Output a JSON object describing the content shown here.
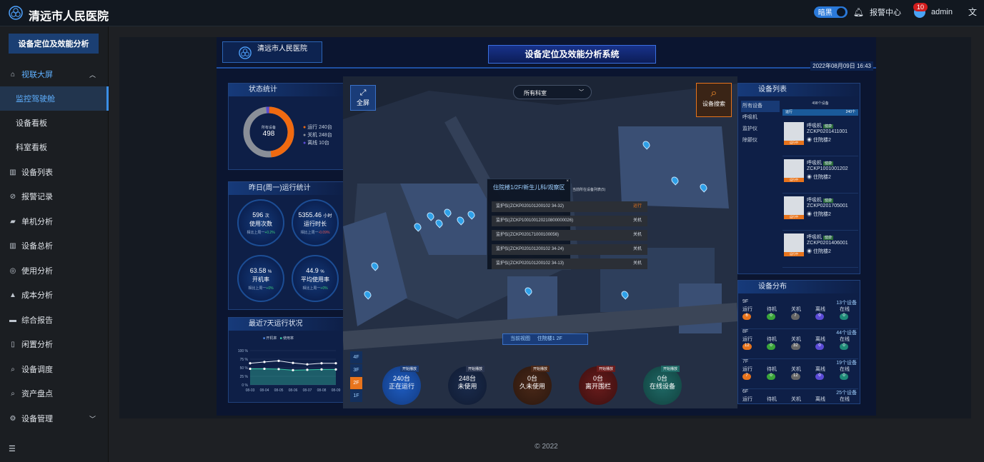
{
  "app": {
    "title": "清远市人民医院"
  },
  "topbar": {
    "theme_label": "暗黑",
    "alarm_label": "报警中心",
    "alarm_count": "10",
    "user": "admin",
    "lang_icon": "translate-icon"
  },
  "sidebar": {
    "title": "设备定位及效能分析",
    "items": [
      {
        "label": "视联大屏",
        "icon": "bank-icon"
      },
      {
        "label": "监控驾驶舱"
      },
      {
        "label": "设备看板"
      },
      {
        "label": "科室看板"
      },
      {
        "label": "设备列表",
        "icon": "bar-chart-icon"
      },
      {
        "label": "报警记录",
        "icon": "compass-icon"
      },
      {
        "label": "单机分析",
        "icon": "device-icon"
      },
      {
        "label": "设备总析",
        "icon": "bar-chart-icon"
      },
      {
        "label": "使用分析",
        "icon": "target-icon"
      },
      {
        "label": "成本分析",
        "icon": "flask-icon"
      },
      {
        "label": "综合报告",
        "icon": "card-icon"
      },
      {
        "label": "闲置分析",
        "icon": "phone-icon"
      },
      {
        "label": "设备调度",
        "icon": "search-icon"
      },
      {
        "label": "资产盘点",
        "icon": "search-icon"
      },
      {
        "label": "设备管理",
        "icon": "gear-icon"
      }
    ]
  },
  "footer": {
    "copyright": "© 2022"
  },
  "screen": {
    "hospital": "清远市人民医院",
    "title": "设备定位及效能分析系统",
    "datetime": "2022年08月09日 16:43",
    "status": {
      "title": "状态统计",
      "center_label": "所有设备",
      "center_value": "498",
      "legend": [
        {
          "label": "运行",
          "value": "240台",
          "color": "#f06a10"
        },
        {
          "label": "关机",
          "value": "248台",
          "color": "#8a8f98"
        },
        {
          "label": "离线",
          "value": "10台",
          "color": "#5b4bd6"
        }
      ]
    },
    "yesterday": {
      "title": "昨日(周一)运行统计",
      "items": [
        {
          "value": "596",
          "unit": "次",
          "label": "使用次数",
          "compare": "相比上周一",
          "delta": "+0.2%"
        },
        {
          "value": "5355.46",
          "unit": "小时",
          "label": "运行时长",
          "compare": "相比上周一",
          "delta": "-0.09%"
        },
        {
          "value": "63.58",
          "unit": "%",
          "label": "开机率",
          "compare": "相比上周一",
          "delta": "+0%"
        },
        {
          "value": "44.9",
          "unit": "%",
          "label": "平均使用率",
          "compare": "相比上周一",
          "delta": "+0%"
        }
      ]
    },
    "week": {
      "title": "最近7天运行状况",
      "legend": [
        "开机率",
        "使用率"
      ]
    },
    "map": {
      "fullscreen": "全屏",
      "dept_select": "所有科室",
      "search": "设备搜索",
      "view_label": "当前视图",
      "view_value": "住院楼1 2F",
      "popup_title": "住院楼1/2F/新生儿科/观察区",
      "popup_sub": "当前所在设备列表(5)",
      "popup_rows": [
        {
          "id": "监护仪(ZCKP020101200102 34-32)",
          "state": "运行",
          "color": "#e8741c"
        },
        {
          "id": "监护仪(ZCKP100100120210800000026)",
          "state": "关机",
          "color": "#888"
        },
        {
          "id": "监护仪(ZCKP020171000100056)",
          "state": "关机",
          "color": "#888"
        },
        {
          "id": "监护仪(ZCKP020101200102 34-24)",
          "state": "关机",
          "color": "#888"
        },
        {
          "id": "监护仪(ZCKP020101200102 34-13)",
          "state": "关机",
          "color": "#888"
        }
      ],
      "floors": [
        "4F",
        "3F",
        "2F",
        "1F"
      ]
    },
    "counts": [
      {
        "value": "240台",
        "label": "正在运行",
        "btn": "开始播放"
      },
      {
        "value": "248台",
        "label": "未使用",
        "btn": "开始播放"
      },
      {
        "value": "0台",
        "label": "久未使用",
        "btn": "开始播放"
      },
      {
        "value": "0台",
        "label": "离开围栏",
        "btn": "开始播放"
      },
      {
        "value": "0台",
        "label": "在线设备",
        "btn": "开始播放"
      }
    ],
    "devices": {
      "title": "设备列表",
      "filters": [
        "所有设备",
        "呼吸机",
        "监护仪",
        "除颤仪"
      ],
      "count_label": "498个设备",
      "tab": "运行",
      "tab_count": "240个",
      "list": [
        {
          "name": "呼吸机",
          "code": "ZCKP0201411001",
          "loc": "住院楼2",
          "status": "运行中",
          "tag": "健康"
        },
        {
          "name": "呼吸机",
          "code": "ZCKP1001001202",
          "loc": "住院楼2",
          "status": "运行中",
          "tag": "健康"
        },
        {
          "name": "呼吸机",
          "code": "ZCKP0201705001",
          "loc": "住院楼2",
          "status": "运行中",
          "tag": "健康"
        },
        {
          "name": "呼吸机",
          "code": "ZCKP0201406001",
          "loc": "住院楼2",
          "status": "运行中",
          "tag": "健康"
        }
      ]
    },
    "distribution": {
      "title": "设备分布",
      "headers": [
        "运行",
        "待机",
        "关机",
        "离线",
        "在线"
      ],
      "floors": [
        {
          "floor": "9F",
          "total": "13个设备",
          "vals": [
            "6",
            "0",
            "7",
            "0",
            "0"
          ]
        },
        {
          "floor": "8F",
          "total": "44个设备",
          "vals": [
            "12",
            "0",
            "32",
            "0",
            "0"
          ]
        },
        {
          "floor": "7F",
          "total": "19个设备",
          "vals": [
            "7",
            "0",
            "12",
            "0",
            "0"
          ]
        },
        {
          "floor": "6F",
          "total": "25个设备",
          "vals": [
            "",
            "",
            "",
            "",
            ""
          ]
        }
      ]
    }
  },
  "chart_data": {
    "type": "line",
    "x": [
      "08-03",
      "08-04",
      "08-05",
      "08-06",
      "08-07",
      "08-08",
      "08-09"
    ],
    "ylim": [
      0,
      100
    ],
    "yticks": [
      "100 %",
      "75 %",
      "50 %",
      "25 %",
      "0 %"
    ],
    "series": [
      {
        "name": "开机率",
        "values": [
          63,
          67,
          70,
          64,
          60,
          63,
          63
        ]
      },
      {
        "name": "使用率",
        "values": [
          47,
          47,
          46,
          43,
          44,
          45,
          45
        ]
      }
    ]
  }
}
